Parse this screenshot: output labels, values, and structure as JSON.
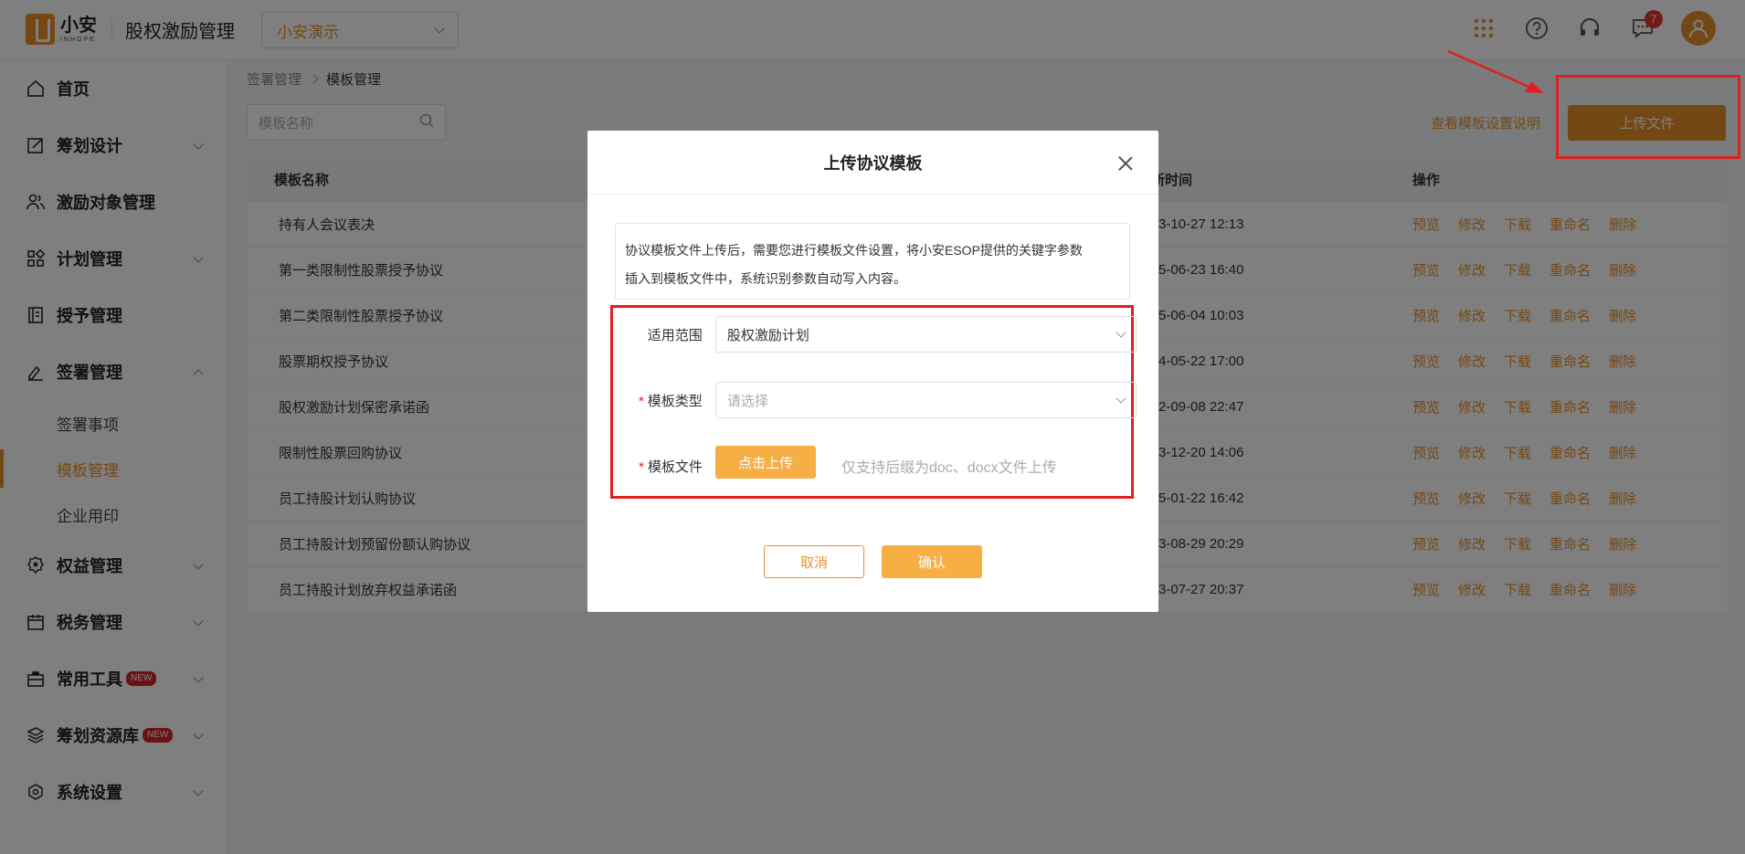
{
  "header": {
    "logo_cn": "小安",
    "logo_en": "INHOPE",
    "app_title": "股权激励管理",
    "company": "小安演示",
    "notification_count": "7",
    "icons": [
      "apps-grid-icon",
      "help-icon",
      "support-icon",
      "message-icon",
      "user-avatar-icon"
    ]
  },
  "sidebar": {
    "items": [
      {
        "label": "首页",
        "icon": "home-icon"
      },
      {
        "label": "筹划设计",
        "icon": "edit-icon"
      },
      {
        "label": "激励对象管理",
        "icon": "users-icon"
      },
      {
        "label": "计划管理",
        "icon": "grid-icon"
      },
      {
        "label": "授予管理",
        "icon": "ledger-icon"
      },
      {
        "label": "签署管理",
        "icon": "sign-icon"
      },
      {
        "label": "权益管理",
        "icon": "badge-icon"
      },
      {
        "label": "税务管理",
        "icon": "tax-icon"
      },
      {
        "label": "常用工具",
        "icon": "toolbox-icon",
        "tag": "NEW"
      },
      {
        "label": "筹划资源库",
        "icon": "layers-icon",
        "tag": "NEW"
      },
      {
        "label": "系统设置",
        "icon": "settings-icon"
      }
    ],
    "sub_items": [
      "签署事项",
      "模板管理",
      "企业用印"
    ]
  },
  "breadcrumb": {
    "parent": "签署管理",
    "current": "模板管理"
  },
  "search": {
    "placeholder": "模板名称"
  },
  "toolbar": {
    "help_link": "查看模板设置说明",
    "upload_label": "上传文件"
  },
  "table": {
    "headers": {
      "name": "模板名称",
      "time": "新时间",
      "ops": "操作"
    },
    "ops": [
      "预览",
      "修改",
      "下载",
      "重命名",
      "删除"
    ],
    "rows": [
      {
        "name": "持有人会议表决",
        "time": "3-10-27 12:13"
      },
      {
        "name": "第一类限制性股票授予协议",
        "time": "5-06-23 16:40"
      },
      {
        "name": "第二类限制性股票授予协议",
        "time": "5-06-04 10:03"
      },
      {
        "name": "股票期权授予协议",
        "time": "4-05-22 17:00"
      },
      {
        "name": "股权激励计划保密承诺函",
        "time": "2-09-08 22:47"
      },
      {
        "name": "限制性股票回购协议",
        "time": "3-12-20 14:06"
      },
      {
        "name": "员工持股计划认购协议",
        "time": "5-01-22 16:42"
      },
      {
        "name": "员工持股计划预留份额认购协议",
        "time": "3-08-29 20:29"
      },
      {
        "name": "员工持股计划放弃权益承诺函",
        "time": "3-07-27 20:37"
      }
    ]
  },
  "modal": {
    "title": "上传协议模板",
    "notice_line1": "协议模板文件上传后，需要您进行模板文件设置，将小安ESOP提供的关键字参数",
    "notice_line2": "插入到模板文件中，系统识别参数自动写入内容。",
    "scope_label": "适用范围",
    "scope_value": "股权激励计划",
    "type_label": "模板类型",
    "type_placeholder": "请选择",
    "file_label": "模板文件",
    "file_button": "点击上传",
    "file_hint": "仅支持后缀为doc、docx文件上传",
    "cancel": "取消",
    "confirm": "确认"
  },
  "colors": {
    "accent": "#e8912a",
    "highlight": "#e02020",
    "button_light": "#f6ae45"
  }
}
